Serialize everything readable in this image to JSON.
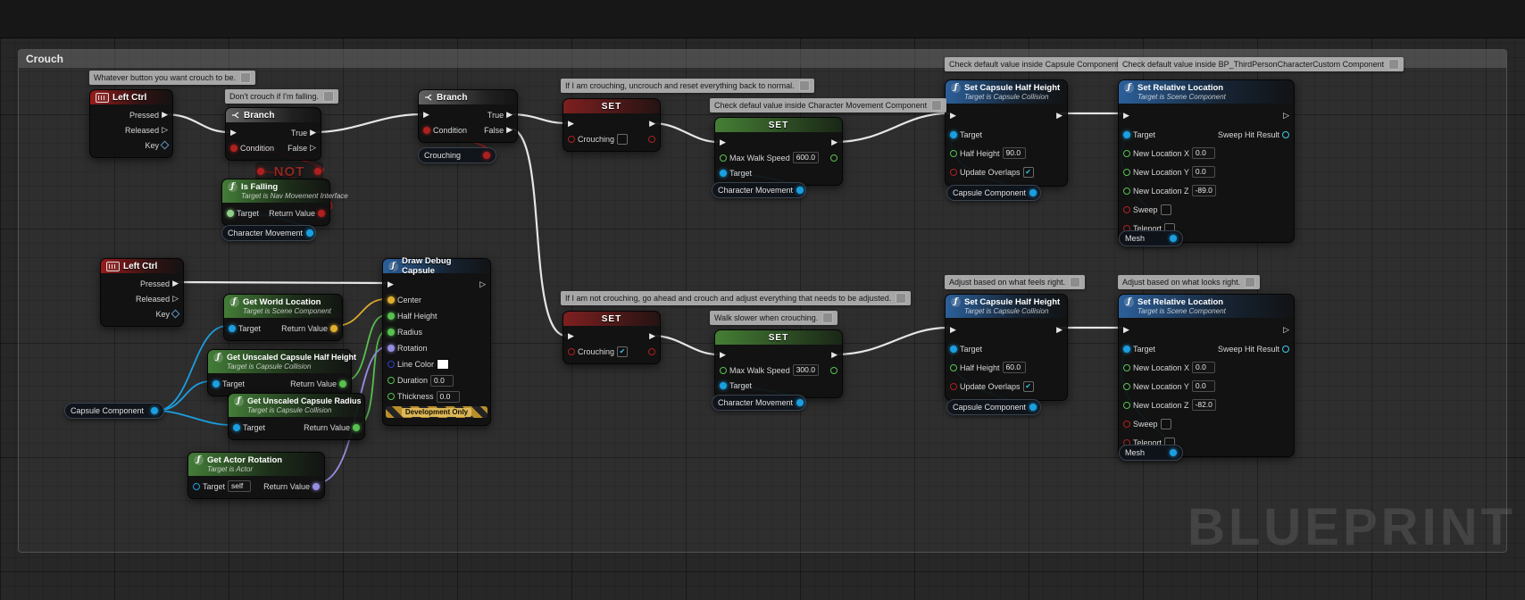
{
  "window": {
    "comment_title": "Crouch",
    "watermark": "BLUEPRINT"
  },
  "icons": {
    "exec_filled": "▶",
    "exec_hollow": "▷",
    "check_glyph": "✔",
    "function_glyph": "ƒ"
  },
  "colors": {
    "exec": "#e6e6e6",
    "bool": "#a82424",
    "float": "#58c24f",
    "object": "#1b9fe0",
    "vector": "#dfae2f",
    "rotator": "#948de0"
  },
  "bubbles": {
    "b1": "Whatever button you want crouch to be.",
    "b2": "Don't crouch if I'm falling.",
    "b3": "If I am crouching, uncrouch and reset everything back to normal.",
    "b4": "Check defaul value inside Character Movement Component",
    "b5": "Check default value inside Capsule Component",
    "b6": "Check default value inside BP_ThirdPersonCharacterCustom Component",
    "b7": "If I am not crouching, go ahead and crouch and adjust everything that needs to be adjusted.",
    "b8": "Walk slower when crouching.",
    "b9": "Adjust based on what feels right.",
    "b10": "Adjust based on what looks right."
  },
  "nodes": {
    "left_ctrl_1": {
      "title": "Left Ctrl",
      "pressed": "Pressed",
      "released": "Released",
      "key": "Key"
    },
    "left_ctrl_2": {
      "title": "Left Ctrl",
      "pressed": "Pressed",
      "released": "Released",
      "key": "Key"
    },
    "branch_1": {
      "title": "Branch",
      "condition": "Condition",
      "true_label": "True",
      "false_label": "False"
    },
    "branch_2": {
      "title": "Branch",
      "condition": "Condition",
      "true_label": "True",
      "false_label": "False"
    },
    "not_node": {
      "title": "NOT"
    },
    "is_falling": {
      "title": "Is Falling",
      "subtitle": "Target is Nav Movement Interface",
      "target": "Target",
      "return_value": "Return Value"
    },
    "char_movement_1": {
      "label": "Character Movement"
    },
    "char_movement_2": {
      "label": "Character Movement"
    },
    "char_movement_3": {
      "label": "Character Movement"
    },
    "crouching_get": {
      "label": "Crouching"
    },
    "set_crouching_1": {
      "title": "SET",
      "var_label": "Crouching",
      "checked": ""
    },
    "set_crouching_2": {
      "title": "SET",
      "var_label": "Crouching",
      "checked": "✔"
    },
    "set_walk_speed_1": {
      "title": "SET",
      "var_label": "Max Walk Speed",
      "value": "600.0",
      "target": "Target"
    },
    "set_walk_speed_2": {
      "title": "SET",
      "var_label": "Max Walk Speed",
      "value": "300.0",
      "target": "Target"
    },
    "set_capsule_1": {
      "title": "Set Capsule Half Height",
      "subtitle": "Target is Capsule Collision",
      "target": "Target",
      "half_height": "Half Height",
      "half_height_value": "90.0",
      "update_overlaps": "Update Overlaps",
      "checked": "✔"
    },
    "set_capsule_2": {
      "title": "Set Capsule Half Height",
      "subtitle": "Target is Capsule Collision",
      "target": "Target",
      "half_height": "Half Height",
      "half_height_value": "60.0",
      "update_overlaps": "Update Overlaps",
      "checked": "✔"
    },
    "set_rel_loc_1": {
      "title": "Set Relative Location",
      "subtitle": "Target is Scene Component",
      "target": "Target",
      "sweep_hit_result": "Sweep Hit Result",
      "new_x": "New Location X",
      "new_y": "New Location Y",
      "new_z": "New Location Z",
      "x_value": "0.0",
      "y_value": "0.0",
      "z_value": "-89.0",
      "sweep": "Sweep",
      "teleport": "Teleport",
      "sweep_checked": "",
      "teleport_checked": ""
    },
    "set_rel_loc_2": {
      "title": "Set Relative Location",
      "subtitle": "Target is Scene Component",
      "target": "Target",
      "sweep_hit_result": "Sweep Hit Result",
      "new_x": "New Location X",
      "new_y": "New Location Y",
      "new_z": "New Location Z",
      "x_value": "0.0",
      "y_value": "0.0",
      "z_value": "-82.0",
      "sweep": "Sweep",
      "teleport": "Teleport",
      "sweep_checked": "",
      "teleport_checked": ""
    },
    "mesh_1": {
      "label": "Mesh"
    },
    "mesh_2": {
      "label": "Mesh"
    },
    "capsule_component_1": {
      "label": "Capsule Component"
    },
    "capsule_component_2": {
      "label": "Capsule Component"
    },
    "capsule_component_3": {
      "label": "Capsule Component"
    },
    "draw_debug_capsule": {
      "title": "Draw Debug Capsule",
      "center": "Center",
      "half_height": "Half Height",
      "radius": "Radius",
      "rotation": "Rotation",
      "line_color": "Line Color",
      "duration": "Duration",
      "duration_value": "0.0",
      "thickness": "Thickness",
      "thickness_value": "0.0",
      "footer": "Development Only"
    },
    "get_world_location": {
      "title": "Get World Location",
      "subtitle": "Target is Scene Component",
      "target": "Target",
      "return_value": "Return Value"
    },
    "get_capsule_half_height": {
      "title": "Get Unscaled Capsule Half Height",
      "subtitle": "Target is Capsule Collision",
      "target": "Target",
      "return_value": "Return Value"
    },
    "get_capsule_radius": {
      "title": "Get Unscaled Capsule Radius",
      "subtitle": "Target is Capsule Collision",
      "target": "Target",
      "return_value": "Return Value"
    },
    "get_actor_rotation": {
      "title": "Get Actor Rotation",
      "subtitle": "Target is Actor",
      "target": "Target",
      "target_value": "self",
      "return_value": "Return Value"
    }
  }
}
